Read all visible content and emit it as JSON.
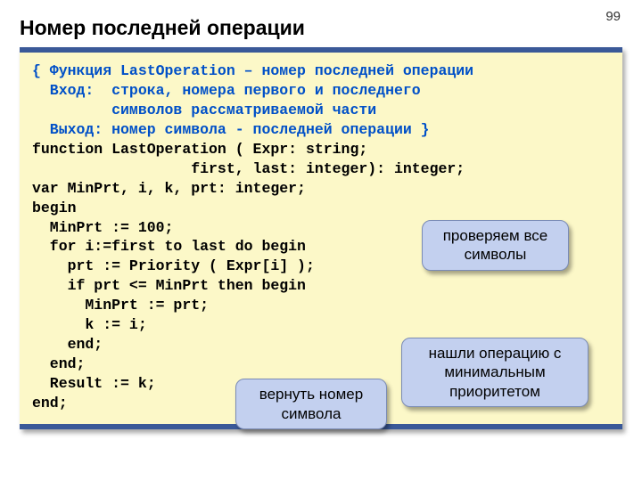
{
  "page_number": "99",
  "title": "Номер последней операции",
  "code": {
    "c1": "{ Функция LastOperation – номер последней операции",
    "c2": "  Вход:  строка, номера первого и последнего",
    "c3": "         символов рассматриваемой части",
    "c4": "  Выход: номер символа - последней операции }",
    "l1": "function LastOperation ( Expr: string;",
    "l2": "                  first, last: integer): integer;",
    "l3": "var MinPrt, i, k, prt: integer;",
    "l4": "begin",
    "l5": "  MinPrt := 100;",
    "l6": "  for i:=first to last do begin",
    "l7": "    prt := Priority ( Expr[i] );",
    "l8": "    if prt <= MinPrt then begin",
    "l9": "      MinPrt := prt;",
    "l10": "      k := i;",
    "l11": "    end;",
    "l12": "  end;",
    "l13": "  Result := k;",
    "l14": "end;"
  },
  "callouts": {
    "check_all": "проверяем все символы",
    "found_min": "нашли операцию с минимальным приоритетом",
    "return_num": "вернуть номер символа"
  }
}
